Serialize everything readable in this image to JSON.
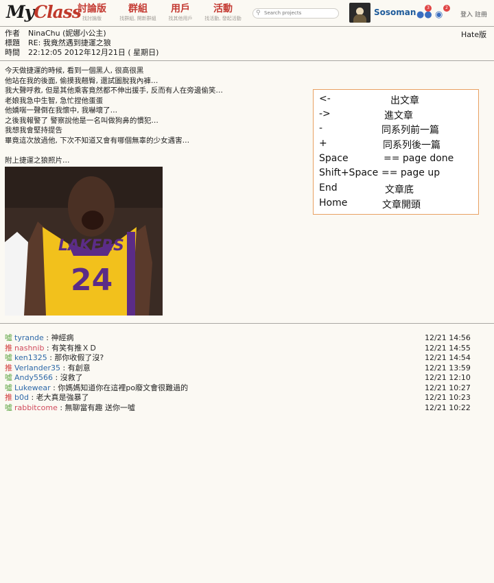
{
  "header": {
    "logo_my": "My",
    "logo_class": "Class",
    "nav": [
      {
        "label": "討論版",
        "sub": "找討論版"
      },
      {
        "label": "群組",
        "sub": "找群組, 開新群組"
      },
      {
        "label": "用戶",
        "sub": "找其他用戶"
      },
      {
        "label": "活動",
        "sub": "找活動, 發起活動"
      }
    ],
    "search_placeholder": "Search projects",
    "username": "Sosoman",
    "friend_badge": "3",
    "message_badge": "2",
    "login": "登入",
    "register": "註冊"
  },
  "post": {
    "author_key": "作者",
    "author": "NinaChu (妮娜小公主)",
    "title_key": "標題",
    "title": "RE: 我竟然遇到捷運之狼",
    "time_key": "時間",
    "time": "22:12:05  2012年12月21日  ( 星期日)",
    "board": "Hate版",
    "lines": [
      "今天做捷運的時候, 看到一個黑人, 很高很黑",
      "他站在我的後面, 偷摸我翹臀, 還試圖脫我內褲…",
      "我大聲呼救, 但是其他乘客竟然都不伸出援手, 反而有人在旁邊偷笑…",
      "老娘我急中生智, 急忙捏他蛋蛋",
      "他嬌喘一聲倒在我懷中, 我嚇壞了…",
      "之後我報警了 警察說他是一名叫做狗鼻的慣犯…",
      "我想我會堅持提告",
      "畢竟這次放過他, 下次不知道又會有哪個無辜的少女遇害…",
      "",
      "附上捷運之狼照片…"
    ],
    "photo": {
      "jersey_team": "LAKERS",
      "jersey_number": "24"
    }
  },
  "shortcuts": [
    {
      "key": "<-",
      "desc": "出文章"
    },
    {
      "key": "->",
      "desc": "進文章"
    },
    {
      "key": "-",
      "desc": "同系列前一篇"
    },
    {
      "key": "+",
      "desc": "同系列後一篇"
    },
    {
      "key": "Space",
      "desc": "==   page done"
    },
    {
      "key": "Shift+Space",
      "desc": "==  page up"
    },
    {
      "key": "End",
      "desc": "文章底"
    },
    {
      "key": "Home",
      "desc": "文章開頭"
    }
  ],
  "comments": [
    {
      "tag": "噓",
      "user": "tyrande",
      "text": " : 神經病",
      "time": "12/21 14:56"
    },
    {
      "tag": "推",
      "user": "nashnib",
      "text": " : 有笑有推ＸＤ",
      "time": "12/21 14:55"
    },
    {
      "tag": "噓",
      "user": "ken1325",
      "text": " : 那你收假了沒?",
      "time": "12/21 14:54"
    },
    {
      "tag": "推",
      "user": "Verlander35",
      "text": " : 有創意",
      "time": "12/21 13:59"
    },
    {
      "tag": "噓",
      "user": "Andy5566",
      "text": " : 沒救了",
      "time": "12/21 12:10"
    },
    {
      "tag": "噓",
      "user": "Lukewear",
      "text": " : 你媽媽知道你在這裡po廢文會很難過的",
      "time": "12/21 10:27"
    },
    {
      "tag": "推",
      "user": "b0d",
      "text": " : 老大真是強暴了",
      "time": "12/21 10:23"
    },
    {
      "tag": "噓",
      "user": "rabbitcome",
      "text": " : 無聊當有趣 送你一噓",
      "time": "12/21 10:22"
    }
  ]
}
